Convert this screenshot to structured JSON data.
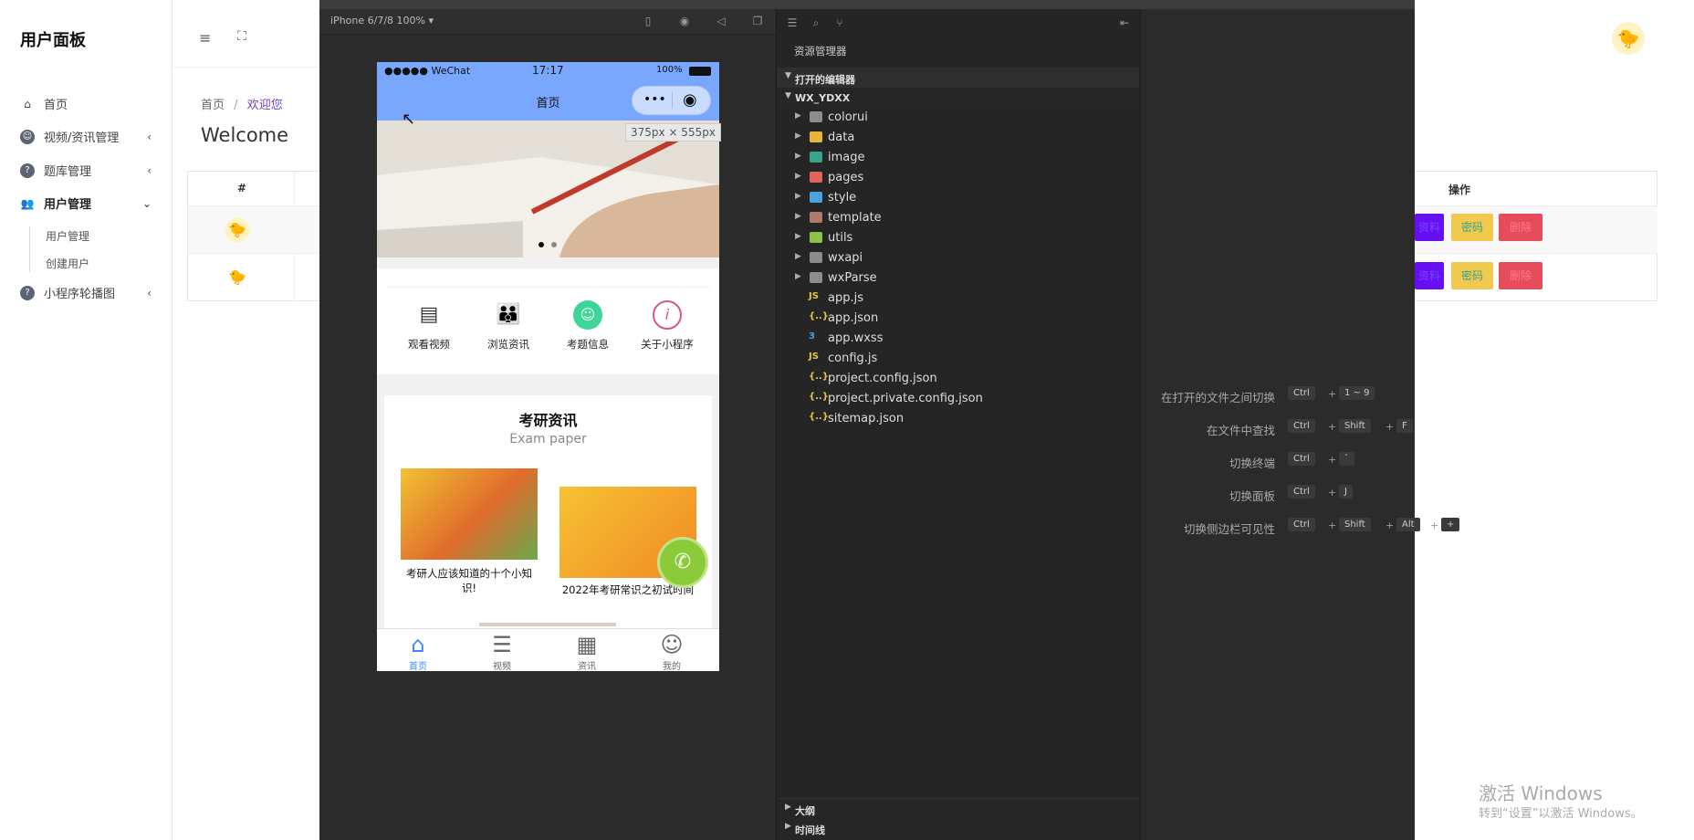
{
  "admin": {
    "brand": "用户面板",
    "sidebar": {
      "items": [
        {
          "label": "首页",
          "icon": "home-icon"
        },
        {
          "label": "视频/资讯管理",
          "icon": "smile-icon"
        },
        {
          "label": "题库管理",
          "icon": "help-circle-icon"
        },
        {
          "label": "用户管理",
          "icon": "user-group-icon"
        },
        {
          "label": "小程序轮播图",
          "icon": "help-circle-icon"
        }
      ],
      "subitems": [
        "用户管理",
        "创建用户"
      ]
    },
    "breadcrumb": {
      "home": "首页",
      "sep": "/",
      "current": "欢迎您"
    },
    "welcome": "Welcome",
    "table": {
      "col_index": "#",
      "col_ops": "操作"
    },
    "ops": {
      "profile": "资料",
      "password": "密码",
      "delete": "删除"
    },
    "windows_activate_title": "激活 Windows",
    "windows_activate_sub": "转到“设置”以激活 Windows。",
    "colors": {
      "accent": "#6f42c1",
      "btn_purple": "#6610f2",
      "btn_yellow": "#f0ad4e",
      "btn_red": "#e74c5c"
    }
  },
  "devtools": {
    "device": "iPhone 6/7/8 100% ▾",
    "size_tip": "375px × 555px",
    "explorer": {
      "title": "资源管理器",
      "open_editors": "打开的编辑器",
      "project": "WX_YDXX",
      "files": [
        {
          "name": "colorui",
          "type": "folder",
          "color": "#8c8c8c"
        },
        {
          "name": "data",
          "type": "folder",
          "color": "#e5b73b"
        },
        {
          "name": "image",
          "type": "folder",
          "color": "#3aa38c"
        },
        {
          "name": "pages",
          "type": "folder",
          "color": "#e0645c"
        },
        {
          "name": "style",
          "type": "folder",
          "color": "#4aa3df"
        },
        {
          "name": "template",
          "type": "folder",
          "color": "#b07a6a"
        },
        {
          "name": "utils",
          "type": "folder",
          "color": "#8bc34a"
        },
        {
          "name": "wxapi",
          "type": "folder",
          "color": "#8c8c8c"
        },
        {
          "name": "wxParse",
          "type": "folder",
          "color": "#8c8c8c"
        },
        {
          "name": "app.js",
          "type": "js"
        },
        {
          "name": "app.json",
          "type": "json"
        },
        {
          "name": "app.wxss",
          "type": "css"
        },
        {
          "name": "config.js",
          "type": "js"
        },
        {
          "name": "project.config.json",
          "type": "json"
        },
        {
          "name": "project.private.config.json",
          "type": "json"
        },
        {
          "name": "sitemap.json",
          "type": "json"
        }
      ],
      "outline": "大纲",
      "timeline": "时间线"
    },
    "shortcuts": [
      {
        "label": "在打开的文件之间切换",
        "keys": [
          "Ctrl",
          "1 ~ 9"
        ]
      },
      {
        "label": "在文件中查找",
        "keys": [
          "Ctrl",
          "Shift",
          "F"
        ]
      },
      {
        "label": "切换终端",
        "keys": [
          "Ctrl",
          "`"
        ]
      },
      {
        "label": "切换面板",
        "keys": [
          "Ctrl",
          "J"
        ]
      },
      {
        "label": "切换侧边栏可见性",
        "keys": [
          "Ctrl",
          "Shift",
          "Alt",
          "+"
        ]
      }
    ]
  },
  "phone": {
    "carrier": "●●●●● WeChat",
    "time": "17:17",
    "battery": "100%",
    "title": "首页",
    "menu": [
      "观看视频",
      "浏览资讯",
      "考题信息",
      "关于小程序"
    ],
    "news_title": "考研资讯",
    "news_sub": "Exam paper",
    "news": [
      "考研人应该知道的十个小知识!",
      "2022年考研常识之初试时间"
    ],
    "tabs": [
      "首页",
      "视频",
      "资讯",
      "我的"
    ]
  }
}
